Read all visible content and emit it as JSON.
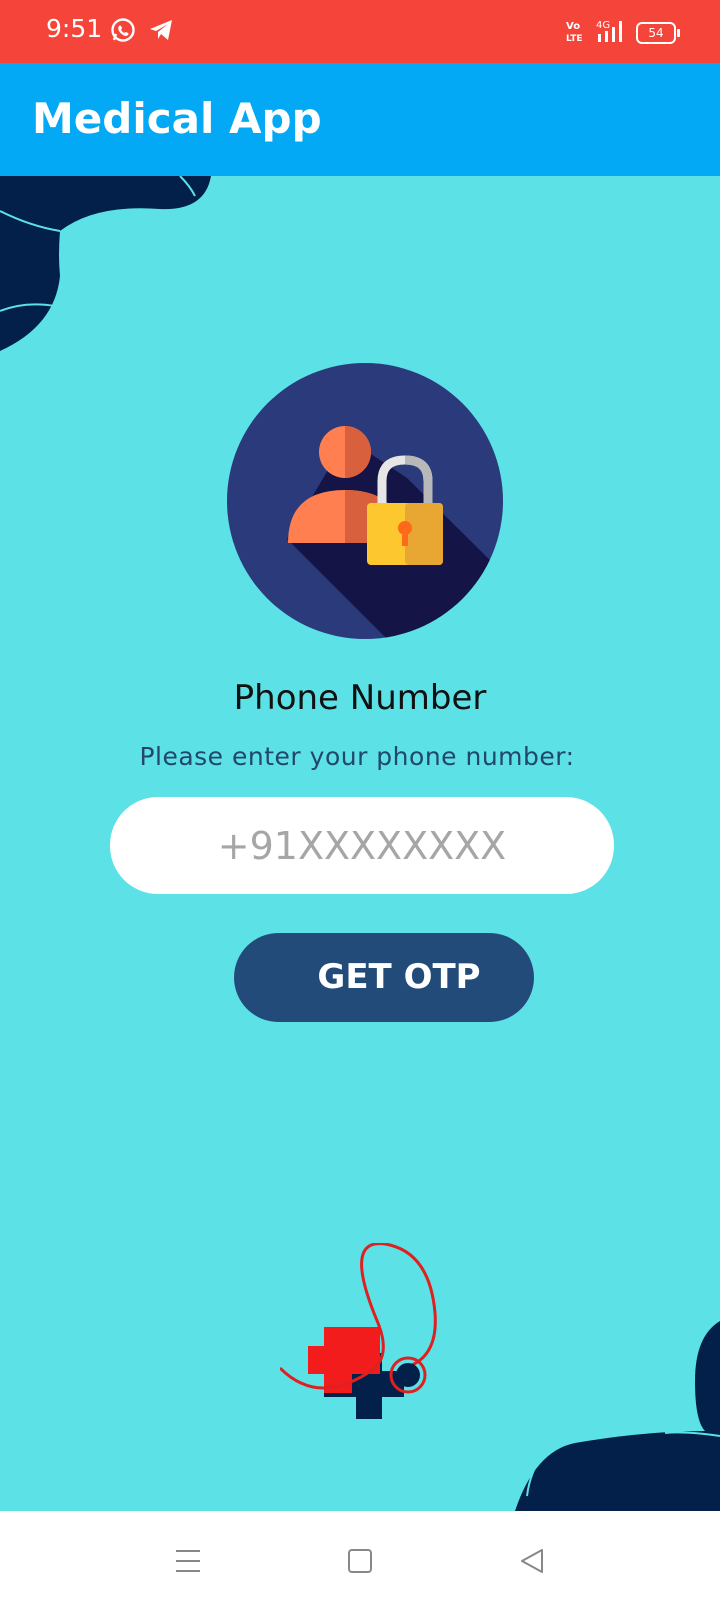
{
  "status": {
    "time": "9:51",
    "battery": "54",
    "network": "4G",
    "volte": "Vo LTE"
  },
  "app": {
    "title": "Medical App"
  },
  "form": {
    "title": "Phone Number",
    "subtitle": "Please enter your phone number:",
    "phone_placeholder": "+91XXXXXXXX",
    "phone_value": "",
    "button_label": "GET OTP"
  },
  "colors": {
    "status_bar": "#f5453a",
    "app_bar": "#03a9f4",
    "background": "#5ce1e6",
    "button": "#224b7a",
    "blob": "#022049"
  },
  "icons": {
    "whatsapp": "whatsapp-icon",
    "telegram": "telegram-icon",
    "signal": "signal-icon",
    "battery": "battery-icon",
    "menu": "menu-icon",
    "home": "home-icon",
    "back": "back-icon"
  }
}
